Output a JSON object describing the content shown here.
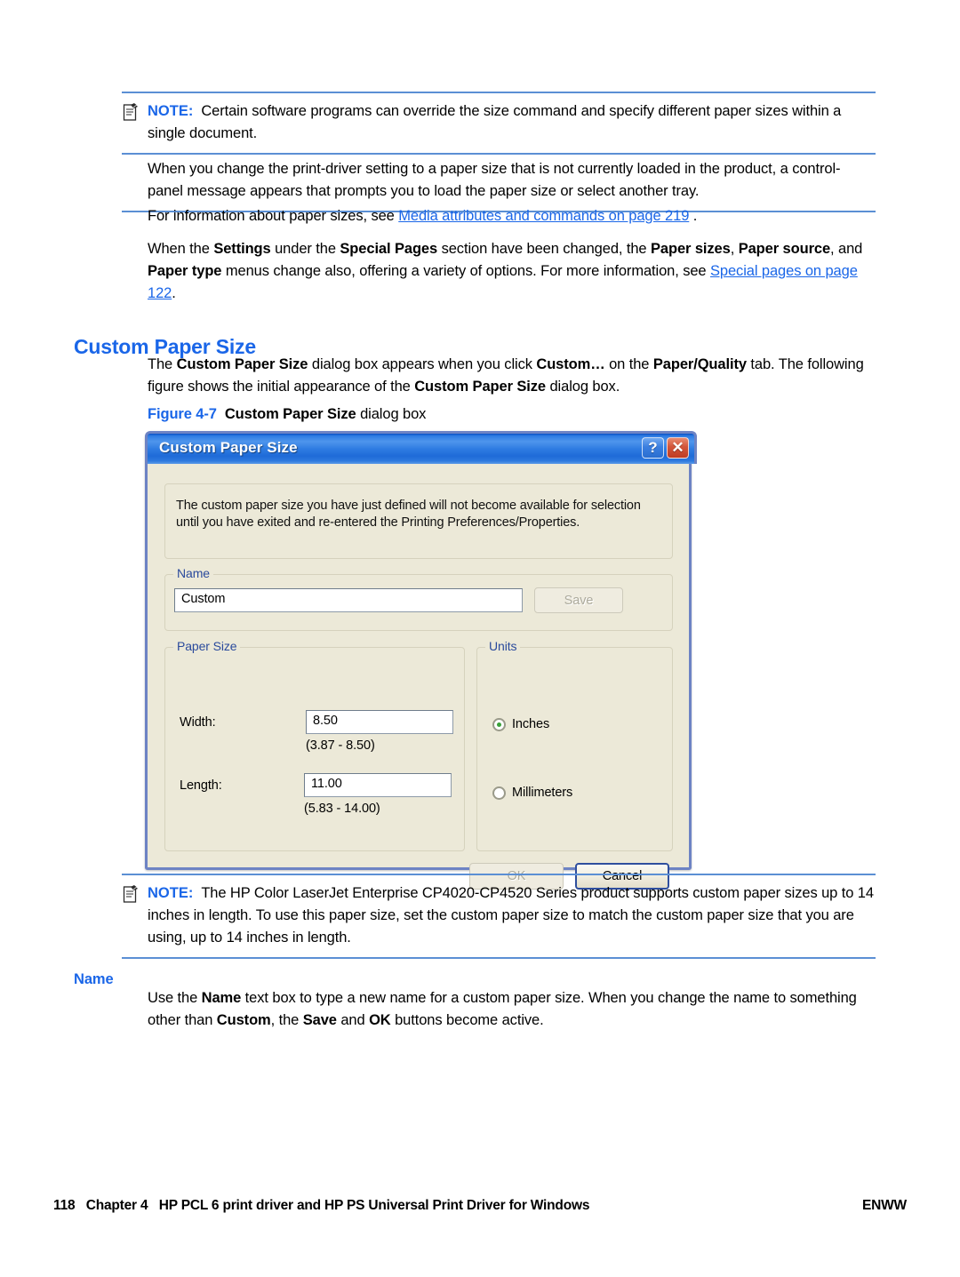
{
  "notes": [
    {
      "label": "NOTE:",
      "icon": "note-icon",
      "text": "Certain software programs can override the size command and specify different paper sizes within a single document."
    },
    {
      "label": "NOTE:",
      "icon": "note-icon",
      "text": "The HP Color LaserJet Enterprise CP4020-CP4520 Series product supports custom paper sizes up to 14 inches in length. To use this paper size, set the custom paper size to match the custom paper size that you are using, up to 14 inches in length."
    }
  ],
  "paragraphs": {
    "p1": "When you change the print-driver setting to a paper size that is not currently loaded in the product, a control-panel message appears that prompts you to load the paper size or select another tray.",
    "p2_pre": "For information about paper sizes, see ",
    "p2_link": "Media attributes and commands on page 219",
    "p2_post": " .",
    "p3_a": "When the ",
    "p3_b1": "Settings",
    "p3_b": " under the ",
    "p3_b2": "Special Pages",
    "p3_c": " section have been changed, the ",
    "p3_b3": "Paper sizes",
    "p3_d": ", ",
    "p3_b4": "Paper source",
    "p3_e": ", and ",
    "p3_b5": "Paper type",
    "p3_f": " menus change also, offering a variety of options. For more information, see ",
    "p3_link": "Special pages on page 122",
    "p3_g": ".",
    "p4_a": "The ",
    "p4_b1": "Custom Paper Size",
    "p4_b": " dialog box appears when you click ",
    "p4_b2": "Custom…",
    "p4_c": " on the ",
    "p4_b3": "Paper/Quality",
    "p4_d": " tab. The following figure shows the initial appearance of the ",
    "p4_b4": "Custom Paper Size",
    "p4_e": " dialog box.",
    "p5_a": "Use the ",
    "p5_b1": "Name",
    "p5_b": " text box to type a new name for a custom paper size. When you change the name to something other than ",
    "p5_b2": "Custom",
    "p5_c": ", the ",
    "p5_b3": "Save",
    "p5_d": " and ",
    "p5_b4": "OK",
    "p5_e": " buttons become active."
  },
  "headings": {
    "section": "Custom Paper Size",
    "subsection": "Name"
  },
  "figure": {
    "number": "Figure 4-7",
    "title_bold": "Custom Paper Size",
    "title_rest": " dialog box"
  },
  "dialog": {
    "title": "Custom Paper Size",
    "help_button": "?",
    "close_button": "✕",
    "info_message": "The custom paper size you have just defined will not become available for selection until you have exited and re-entered the Printing Preferences/Properties.",
    "name_group_label": "Name",
    "name_value": "Custom",
    "save_label": "Save",
    "paper_size_group_label": "Paper Size",
    "width_label": "Width:",
    "width_value": "8.50",
    "width_range": "(3.87 - 8.50)",
    "length_label": "Length:",
    "length_value": "11.00",
    "length_range": "(5.83 - 14.00)",
    "units_group_label": "Units",
    "unit_inches": "Inches",
    "unit_millimeters": "Millimeters",
    "selected_unit": "Inches",
    "ok_label": "OK",
    "cancel_label": "Cancel"
  },
  "footer": {
    "left": "118   Chapter 4   HP PCL 6 print driver and HP PS Universal Print Driver for Windows",
    "right": "ENWW"
  },
  "colors": {
    "accent_blue": "#1a66e8",
    "rule_blue": "#5b8fd4",
    "dialog_face": "#ece9d8",
    "title_blue": "#2f7de4",
    "radio_green": "#3aa13a"
  }
}
